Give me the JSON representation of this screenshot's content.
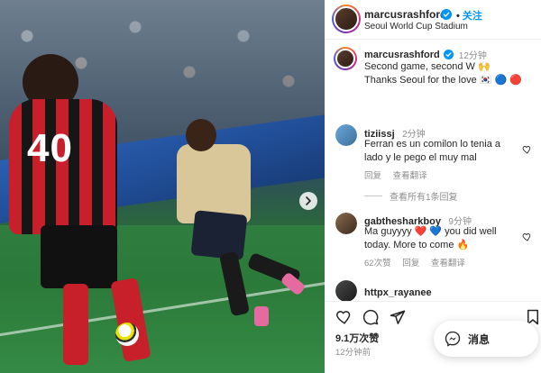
{
  "post": {
    "author": "marcusrashford",
    "follow_label": "关注",
    "location": "Seoul World Cup Stadium",
    "caption_time": "12分钟",
    "caption_line1": "Second game, second W 🙌",
    "caption_line2": "Thanks Seoul for the love 🇰🇷 🔵 🔴",
    "more_icon": "more-horizontal-icon",
    "image_jersey_number": "40"
  },
  "comments": [
    {
      "user": "tiziissj",
      "time": "2分钟",
      "text": "Ferran es un comilon lo tenia a lado y le pego el muy mal",
      "likes": "",
      "reply_label": "回复",
      "translate_label": "查看翻译"
    },
    {
      "user": "gabthesharkboy",
      "time": "9分钟",
      "text": "Ma guyyyy ❤️ 💙 you did well today. More to come 🔥",
      "likes": "62次赞",
      "reply_label": "回复",
      "translate_label": "查看翻译"
    },
    {
      "user": "httpx_rayanee"
    }
  ],
  "view_replies_label": "查看所有1条回复",
  "actions": {
    "likes_count": "9.1万次赞",
    "post_time": "12分钟前"
  },
  "message_button_label": "消息",
  "colors": {
    "accent_blue": "#0095f6",
    "muted_gray": "#8e8e8e",
    "text_dark": "#262626"
  }
}
